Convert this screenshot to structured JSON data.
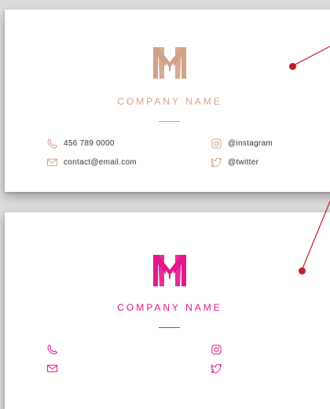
{
  "colors": {
    "gold": "#d2a288",
    "pink": "#e4178c",
    "marker": "#c41e2a",
    "text": "#333333"
  },
  "card_top": {
    "company_name": "COMPANY NAME",
    "logo_icon": "m-monogram-icon",
    "contacts": [
      {
        "icon": "phone-icon",
        "text": "456 789 0000"
      },
      {
        "icon": "email-icon",
        "text": "contact@email.com"
      },
      {
        "icon": "instagram-icon",
        "text": "@instagram"
      },
      {
        "icon": "twitter-icon",
        "text": "@twitter"
      }
    ]
  },
  "card_bottom": {
    "company_name": "COMPANY NAME",
    "logo_icon": "m-monogram-icon",
    "contacts": [
      {
        "icon": "phone-icon",
        "text": ""
      },
      {
        "icon": "email-icon",
        "text": ""
      },
      {
        "icon": "instagram-icon",
        "text": ""
      },
      {
        "icon": "twitter-icon",
        "text": ""
      }
    ]
  }
}
